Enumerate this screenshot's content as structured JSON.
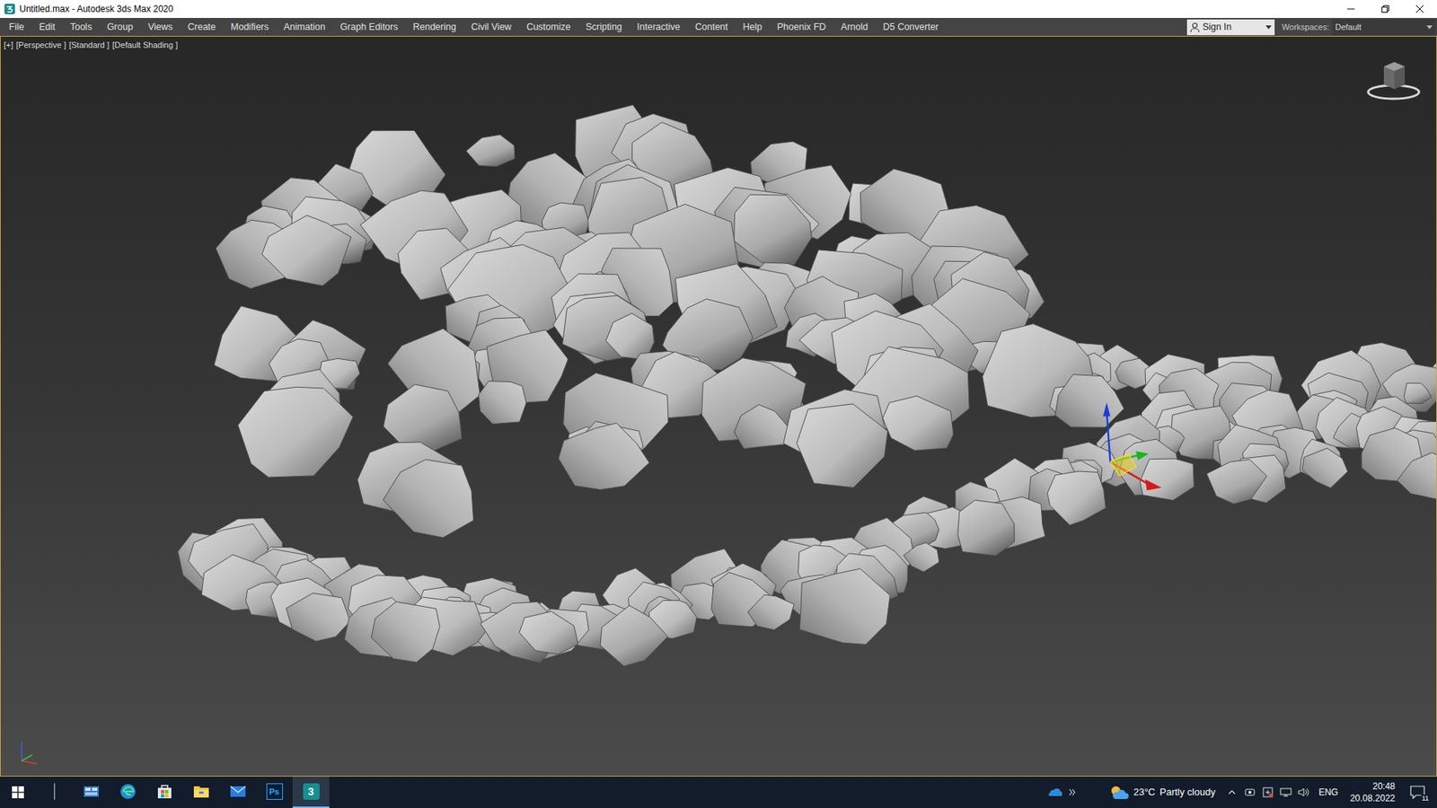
{
  "window": {
    "title": "Untitled.max - Autodesk 3ds Max 2020"
  },
  "menu": [
    "File",
    "Edit",
    "Tools",
    "Group",
    "Views",
    "Create",
    "Modifiers",
    "Animation",
    "Graph Editors",
    "Rendering",
    "Civil View",
    "Customize",
    "Scripting",
    "Interactive",
    "Content",
    "Help",
    "Phoenix FD",
    "Arnold",
    "D5 Converter"
  ],
  "account": {
    "label": "Sign In"
  },
  "workspaces": {
    "label": "Workspaces:",
    "value": "Default"
  },
  "viewport": {
    "labels": [
      "[+]",
      "[Perspective ]",
      "[Standard ]",
      "[Default Shading ]"
    ],
    "active": true
  },
  "taskbar": {
    "apps": [
      {
        "kind": "search",
        "active": false
      },
      {
        "kind": "taskview",
        "active": false
      },
      {
        "kind": "edge",
        "active": false
      },
      {
        "kind": "store",
        "active": false
      },
      {
        "kind": "explorer",
        "active": false
      },
      {
        "kind": "mail",
        "active": false
      },
      {
        "kind": "photoshop",
        "label": "Ps",
        "active": false
      },
      {
        "kind": "max",
        "label": "3",
        "active": true
      }
    ],
    "weather": {
      "temp": "23°C",
      "condition": "Partly cloudy"
    },
    "language": "ENG",
    "time": "20:48",
    "date": "20.08.2022",
    "notifications": "11"
  }
}
